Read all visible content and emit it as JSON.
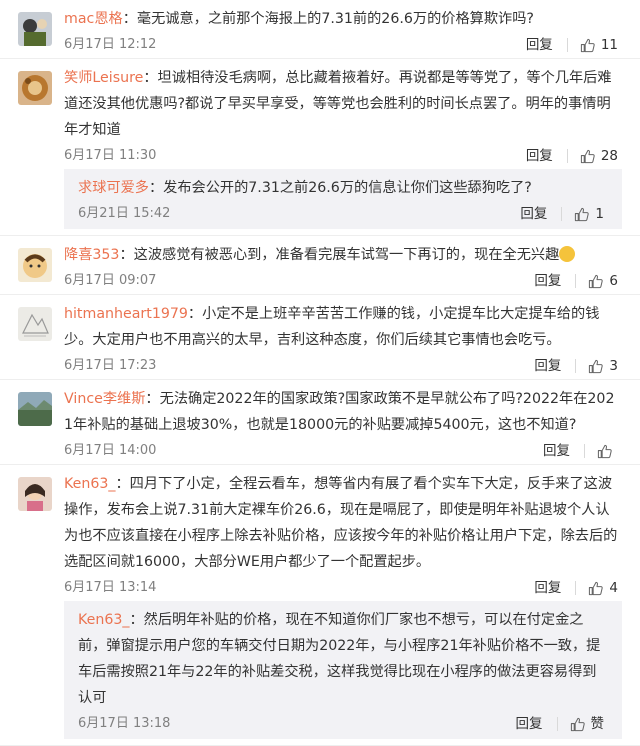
{
  "comments": [
    {
      "user": "mac恩格",
      "text": "毫无诚意，之前那个海报上的7.31前的26.6万的价格算欺诈吗?",
      "time": "6月17日 12:12",
      "reply_label": "回复",
      "likes": "11"
    },
    {
      "user": "笑师Leisure",
      "text": "坦诚相待没毛病啊，总比藏着掖着好。再说都是等等党了，等个几年后难道还没其他优惠吗?都说了早买早享受，等等党也会胜利的时间长点罢了。明年的事情明年才知道",
      "time": "6月17日 11:30",
      "reply_label": "回复",
      "likes": "28",
      "sub": {
        "user": "求球可爱多",
        "text": "发布会公开的7.31之前26.6万的信息让你们这些舔狗吃了?",
        "time": "6月21日 15:42",
        "reply_label": "回复",
        "likes": "1"
      }
    },
    {
      "user": "降喜353",
      "text": "这波感觉有被恶心到，准备看完展车试驾一下再订的，现在全无兴趣",
      "time": "6月17日 09:07",
      "reply_label": "回复",
      "likes": "6"
    },
    {
      "user": "hitmanheart1979",
      "text": "小定不是上班辛辛苦苦工作赚的钱，小定提车比大定提车给的钱少。大定用户也不用高兴的太早，吉利这种态度，你们后续其它事情也会吃亏。",
      "time": "6月17日 17:23",
      "reply_label": "回复",
      "likes": "3"
    },
    {
      "user": "Vince李维斯",
      "text": "无法确定2022年的国家政策?国家政策不是早就公布了吗?2022年在2021年补贴的基础上退坡30%，也就是18000元的补贴要减掉5400元，这也不知道?",
      "time": "6月17日 14:00",
      "reply_label": "回复",
      "likes": ""
    },
    {
      "user": "Ken63_",
      "text": "四月下了小定，全程云看车，想等省内有展了看个实车下大定，反手来了这波操作，发布会上说7.31前大定裸车价26.6，现在是嗝屁了，即使是明年补贴退坡个人认为也不应该直接在小程序上除去补贴价格，应该按今年的补贴价格让用户下定，除去后的选配区间就16000，大部分WE用户都少了一个配置起步。",
      "time": "6月17日 13:14",
      "reply_label": "回复",
      "likes": "4",
      "sub": {
        "user": "Ken63_",
        "text": "然后明年补贴的价格，现在不知道你们厂家也不想亏，可以在付定金之前，弹窗提示用户您的车辆交付日期为2022年，与小程序21年补贴价格不一致，提车后需按照21年与22年的补贴差交税，这样我觉得比现在小程序的做法更容易得到认可",
        "time": "6月17日 13:18",
        "reply_label": "回复",
        "likes": "赞"
      }
    }
  ]
}
